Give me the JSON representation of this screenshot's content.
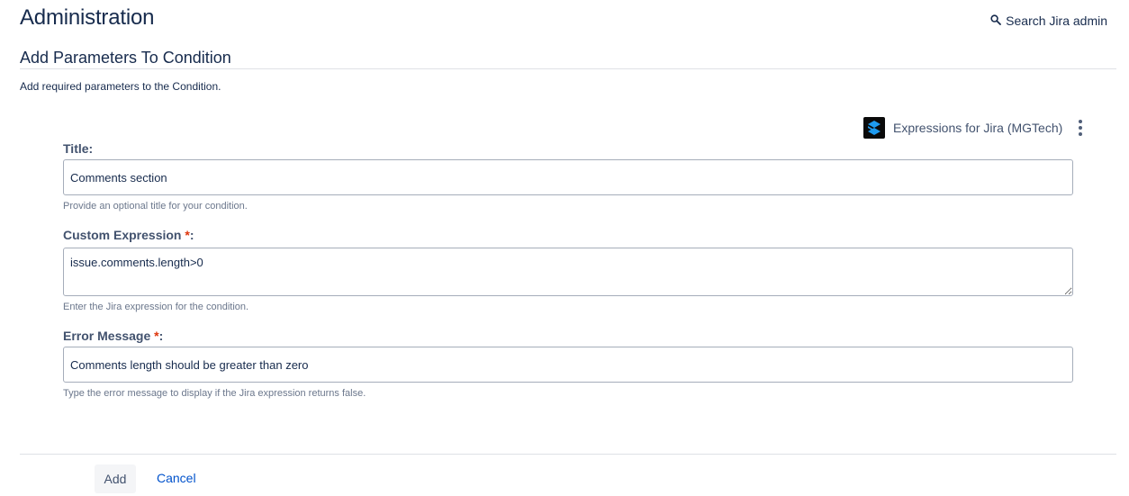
{
  "header": {
    "title": "Administration",
    "search_label": "Search Jira admin"
  },
  "section": {
    "title": "Add Parameters To Condition",
    "description": "Add required parameters to the Condition."
  },
  "vendor": {
    "name": "Expressions for Jira (MGTech)"
  },
  "form": {
    "title_field": {
      "label": "Title:",
      "value": "Comments section",
      "help": "Provide an optional title for your condition."
    },
    "expression_field": {
      "label": "Custom Expression",
      "required_mark": "*",
      "colon": ":",
      "value": "issue.comments.length>0",
      "help": "Enter the Jira expression for the condition."
    },
    "error_field": {
      "label": "Error Message",
      "required_mark": "*",
      "colon": ":",
      "value": "Comments length should be greater than zero",
      "help": "Type the error message to display if the Jira expression returns false."
    }
  },
  "actions": {
    "add_label": "Add",
    "cancel_label": "Cancel"
  },
  "colors": {
    "text": "#172b4d",
    "link": "#0052cc",
    "required": "#de350b",
    "border": "#a5adba"
  },
  "icons": {
    "search": "search-icon",
    "vendor_logo": "expressions-logo-icon",
    "more": "more-vertical-icon"
  }
}
